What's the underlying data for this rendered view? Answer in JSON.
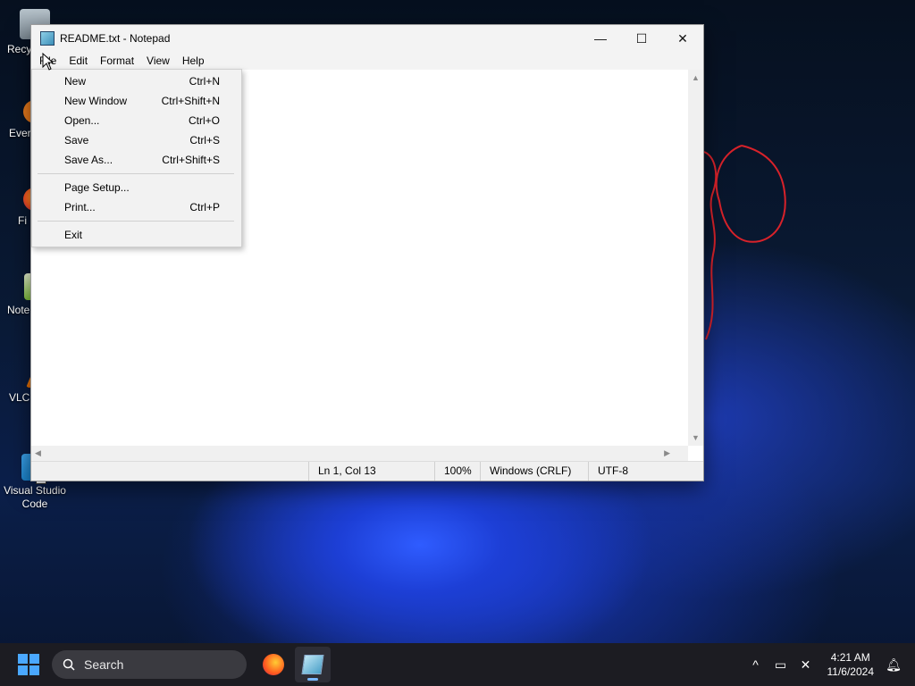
{
  "desktop": {
    "icons": [
      {
        "label": "Recy",
        "icon": "recycle-bin-icon"
      },
      {
        "label": "Ever",
        "icon": "everything-icon"
      },
      {
        "label": "Fi",
        "icon": "firefox-icon"
      },
      {
        "label": "Note",
        "icon": "notepad-plus-icon"
      },
      {
        "label": "VLC pl",
        "icon": "vlc-icon"
      },
      {
        "label": "Visual Studio Code",
        "icon": "vscode-icon"
      }
    ]
  },
  "window": {
    "title": "README.txt - Notepad",
    "controls": {
      "minimize": "—",
      "maximize": "☐",
      "close": "✕"
    },
    "menu": [
      "File",
      "Edit",
      "Format",
      "View",
      "Help"
    ]
  },
  "file_menu": {
    "items": [
      {
        "label": "New",
        "shortcut": "Ctrl+N"
      },
      {
        "label": "New Window",
        "shortcut": "Ctrl+Shift+N"
      },
      {
        "label": "Open...",
        "shortcut": "Ctrl+O"
      },
      {
        "label": "Save",
        "shortcut": "Ctrl+S"
      },
      {
        "label": "Save As...",
        "shortcut": "Ctrl+Shift+S"
      },
      {
        "label": "Page Setup...",
        "shortcut": ""
      },
      {
        "label": "Print...",
        "shortcut": "Ctrl+P"
      },
      {
        "label": "Exit",
        "shortcut": ""
      }
    ]
  },
  "statusbar": {
    "position": "Ln 1, Col 13",
    "zoom": "100%",
    "line_ending": "Windows (CRLF)",
    "encoding": "UTF-8"
  },
  "taskbar": {
    "search_label": "Search",
    "time": "4:21 AM",
    "date": "11/6/2024"
  },
  "colors": {
    "accent": "#4aa8ff",
    "menu_bg": "#f2f2f2",
    "taskbar_bg": "#1c1c22"
  }
}
